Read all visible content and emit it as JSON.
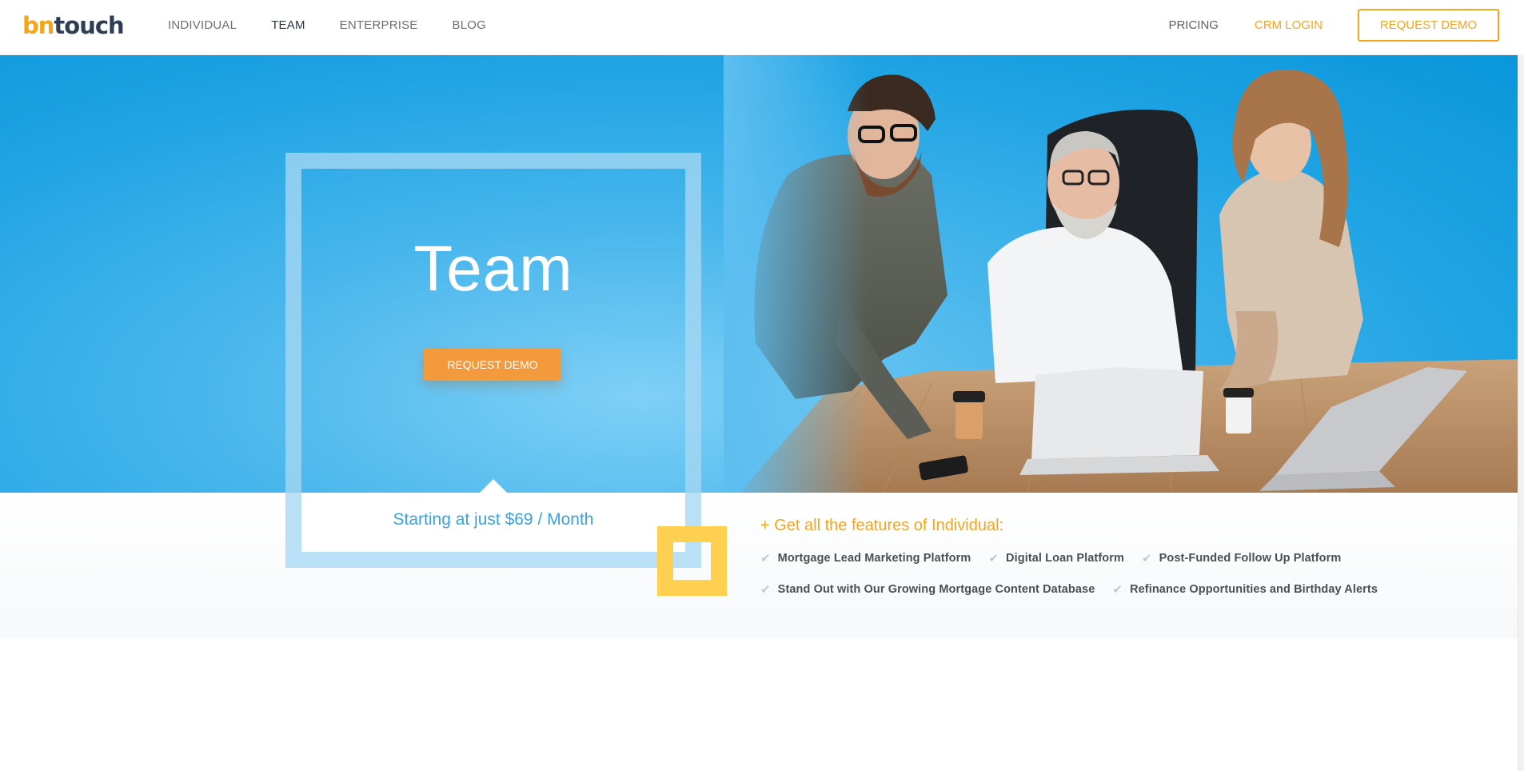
{
  "logo": {
    "part1": "bn",
    "part2": "touch"
  },
  "nav": {
    "items": [
      {
        "label": "INDIVIDUAL",
        "active": false
      },
      {
        "label": "TEAM",
        "active": true
      },
      {
        "label": "ENTERPRISE",
        "active": false
      },
      {
        "label": "BLOG",
        "active": false
      }
    ],
    "pricing": "PRICING",
    "crm_login": "CRM LOGIN",
    "request_demo": "REQUEST DEMO"
  },
  "hero": {
    "title": "Team",
    "cta": "REQUEST DEMO",
    "price_text": "Starting at just $69 / Month",
    "photo": "team-meeting-photo"
  },
  "features": {
    "heading": "+ Get all the features of Individual:",
    "row1": [
      "Mortgage Lead Marketing Platform",
      "Digital Loan Platform",
      "Post-Funded Follow Up Platform"
    ],
    "row2": [
      "Stand Out with Our Growing Mortgage Content Database",
      "Refinance Opportunities and Birthday Alerts"
    ]
  },
  "colors": {
    "accent": "#f2a51d",
    "hero_blue": "#1ea3e3",
    "button_orange": "#f39a3c",
    "frame_yellow": "#fdd04f",
    "price_blue": "#3aa3de"
  }
}
